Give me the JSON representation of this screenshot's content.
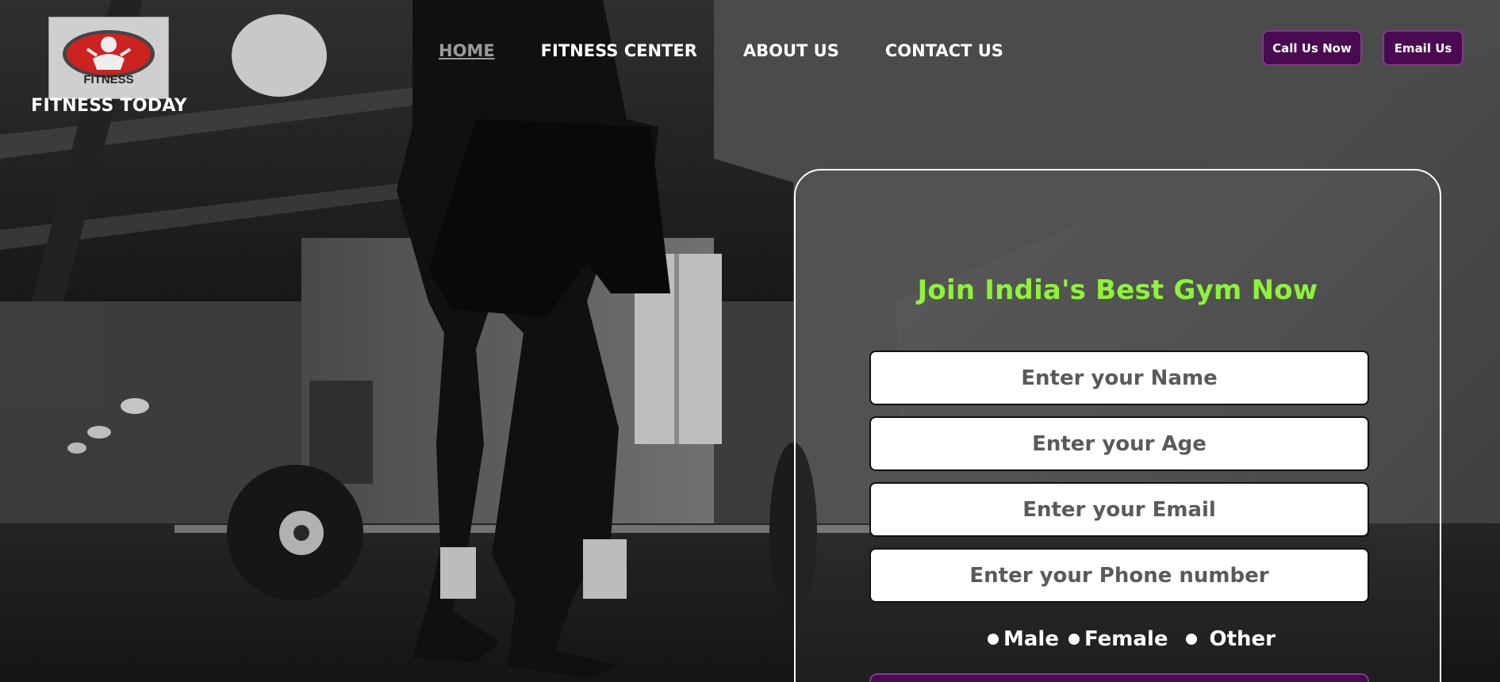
{
  "header": {
    "logo_text": "FITNESS",
    "brand_name": "FITNESS TODAY",
    "nav": [
      {
        "label": "HOME",
        "active": true
      },
      {
        "label": "FITNESS CENTER",
        "active": false
      },
      {
        "label": "ABOUT US",
        "active": false
      },
      {
        "label": "CONTACT US",
        "active": false
      }
    ],
    "call_button": "Call Us Now",
    "email_button": "Email Us"
  },
  "form": {
    "title": "Join India's Best Gym Now",
    "name_placeholder": "Enter your Name",
    "age_placeholder": "Enter your Age",
    "email_placeholder": "Enter your Email",
    "phone_placeholder": "Enter your Phone number",
    "gender_options": [
      "Male",
      "Female",
      "Other"
    ]
  },
  "colors": {
    "accent_purple": "#4a0a52",
    "title_green": "#8ef23a"
  }
}
